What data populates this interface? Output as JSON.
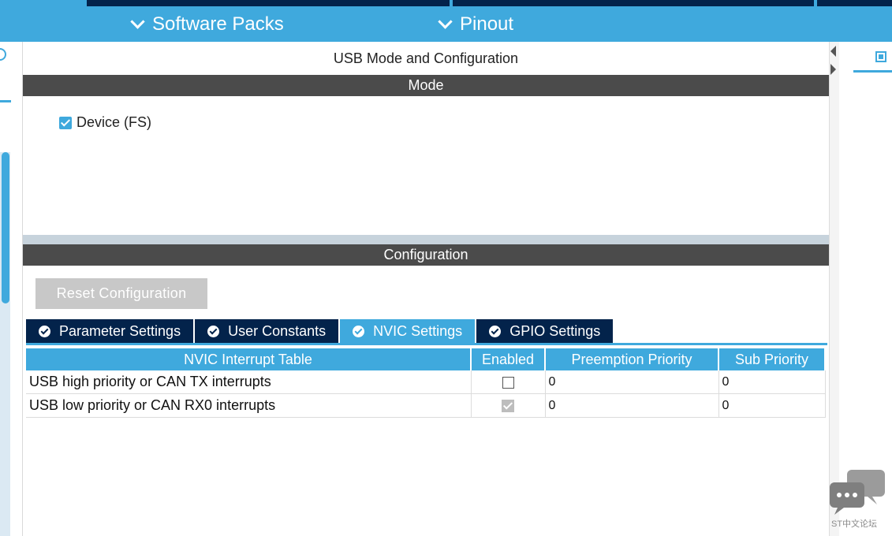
{
  "header": {
    "software_packs": "Software Packs",
    "pinout": "Pinout"
  },
  "panel": {
    "title": "USB Mode and Configuration",
    "mode_bar": "Mode",
    "device_checkbox_label": "Device (FS)",
    "device_checked": true,
    "configuration_bar": "Configuration",
    "reset_button": "Reset Configuration"
  },
  "tabs": [
    {
      "label": "Parameter Settings",
      "active": false
    },
    {
      "label": "User Constants",
      "active": false
    },
    {
      "label": "NVIC Settings",
      "active": true
    },
    {
      "label": "GPIO Settings",
      "active": false
    }
  ],
  "table": {
    "headers": [
      "NVIC Interrupt Table",
      "Enabled",
      "Preemption Priority",
      "Sub Priority"
    ],
    "rows": [
      {
        "name": "USB high priority or CAN TX interrupts",
        "enabled": false,
        "preemption": "0",
        "sub": "0"
      },
      {
        "name": "USB low priority or CAN RX0 interrupts",
        "enabled": true,
        "preemption": "0",
        "sub": "0"
      }
    ]
  },
  "watermark": "ST中文论坛",
  "colors": {
    "accent": "#3fa9dd",
    "navy": "#03234b",
    "bar_gray": "#4b4b4b"
  }
}
